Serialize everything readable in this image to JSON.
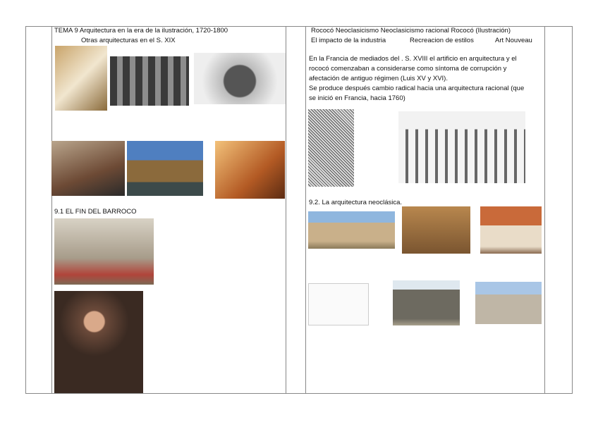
{
  "left": {
    "title": "TEMA 9 Arquitectura en la era de la ilustración, 1720-1800",
    "subtitle": "Otras arquitecturas en el S. XIX",
    "section": "9.1 EL FIN DEL BARROCO"
  },
  "right": {
    "topics_row1": "Rococó   Neoclasicismo   Neoclasicismo racional Rococó (Ilustración)",
    "topics_row2": [
      "El impacto de la industria",
      "Recreacion de estilos",
      "Art Nouveau"
    ],
    "paragraph": [
      "En la Francia de mediados del . S. XVIII el artificio en arquitectura y el",
      "rococó comenzaban a considerarse como síntoma de corrupción y",
      "afectación de antiguo régimen (Luis XV y XVI).",
      "Se produce después cambio radical hacia una arquitectura racional (que",
      "se inició en Francia, hacia 1760)"
    ],
    "section": "9.2. La arquitectura neoclásica."
  }
}
